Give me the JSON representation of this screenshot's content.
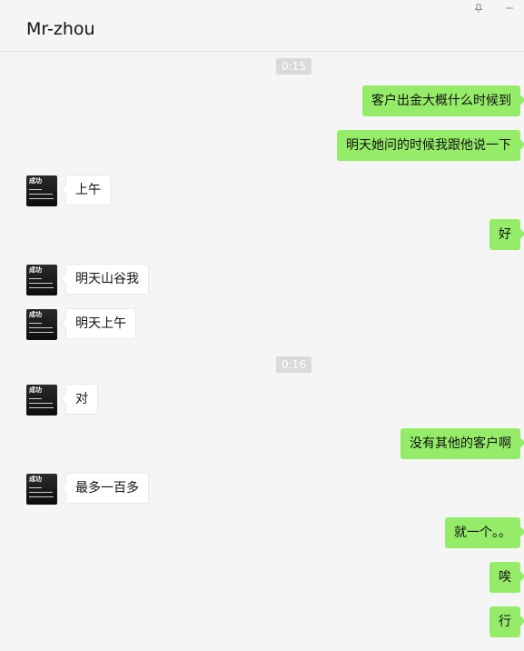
{
  "window": {
    "title": "Mr-zhou",
    "pin_icon": "pin-icon",
    "minimize_icon": "minimize-icon"
  },
  "avatar": {
    "contact_text": "成功"
  },
  "messages": [
    {
      "kind": "time",
      "text": "0:15"
    },
    {
      "kind": "out",
      "text": "客户出金大概什么时候到"
    },
    {
      "kind": "out",
      "text": "明天她问的时候我跟他说一下"
    },
    {
      "kind": "in",
      "text": "上午"
    },
    {
      "kind": "out",
      "text": "好"
    },
    {
      "kind": "in",
      "text": "明天山谷我"
    },
    {
      "kind": "in",
      "text": "明天上午"
    },
    {
      "kind": "time",
      "text": "0:16"
    },
    {
      "kind": "in",
      "text": "对"
    },
    {
      "kind": "out",
      "text": "没有其他的客户啊"
    },
    {
      "kind": "in",
      "text": "最多一百多"
    },
    {
      "kind": "out",
      "text": "就一个。。"
    },
    {
      "kind": "out",
      "text": "唉"
    },
    {
      "kind": "out",
      "text": "行"
    }
  ],
  "colors": {
    "outgoing_bubble": "#95ec69",
    "incoming_bubble": "#ffffff",
    "background": "#f5f5f5",
    "time_badge": "#dadada"
  }
}
